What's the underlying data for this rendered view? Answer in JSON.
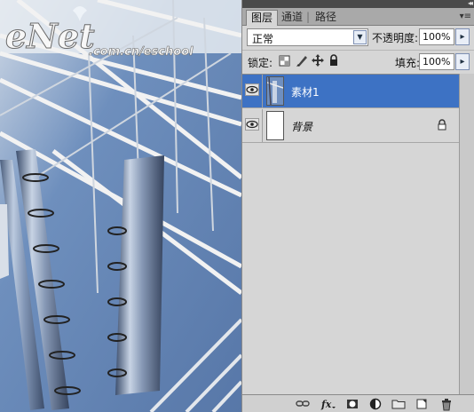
{
  "watermark": {
    "brand": "eNet",
    "site": ".com.cn/eschool"
  },
  "panel": {
    "collapse_glyph": "◂◂",
    "menu_glyph": "▾≡",
    "tabs": [
      {
        "label": "图层",
        "active": true
      },
      {
        "label": "通道",
        "active": false
      },
      {
        "label": "路径",
        "active": false
      }
    ],
    "blend_mode": "正常",
    "opacity_label": "不透明度:",
    "opacity_value": "100%",
    "lock_label": "锁定:",
    "fill_label": "填充:",
    "fill_value": "100%",
    "arrow_glyph": "▸",
    "dropdown_glyph": "▼",
    "layers": [
      {
        "name": "素材1",
        "selected": true,
        "visible": true,
        "locked": false
      },
      {
        "name": "背景",
        "selected": false,
        "visible": true,
        "locked": true
      }
    ],
    "icons": {
      "lock_row": [
        "lock-transparent-pixels-icon",
        "lock-image-pixels-icon",
        "lock-position-icon",
        "lock-all-icon"
      ],
      "bottom_bar": [
        "link-layers-icon",
        "layer-style-icon",
        "layer-mask-icon",
        "adjustment-layer-icon",
        "new-group-icon",
        "new-layer-icon",
        "delete-layer-icon"
      ]
    },
    "colors": {
      "selected_row": "#3d72c4",
      "panel_bg": "#d6d6d6"
    }
  }
}
